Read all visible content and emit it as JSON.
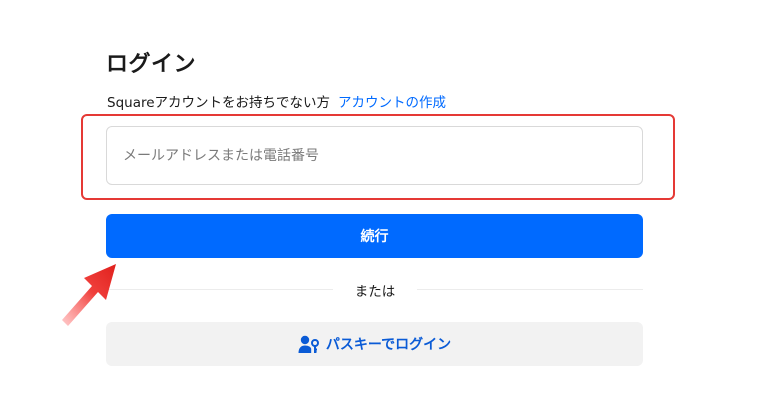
{
  "login": {
    "title": "ログイン",
    "no_account_text": "Squareアカウントをお持ちでない方",
    "create_account_link": "アカウントの作成",
    "email_placeholder": "メールアドレスまたは電話番号",
    "email_value": "",
    "continue_label": "続行",
    "divider_label": "または",
    "passkey_label": "パスキーでログイン"
  },
  "icons": {
    "passkey": "person-key-icon",
    "annotation": "red-arrow-icon"
  },
  "colors": {
    "primary": "#006aff",
    "passkey_text": "#0a5bd6",
    "highlight": "#e53935",
    "secondary_bg": "#f2f2f2"
  }
}
